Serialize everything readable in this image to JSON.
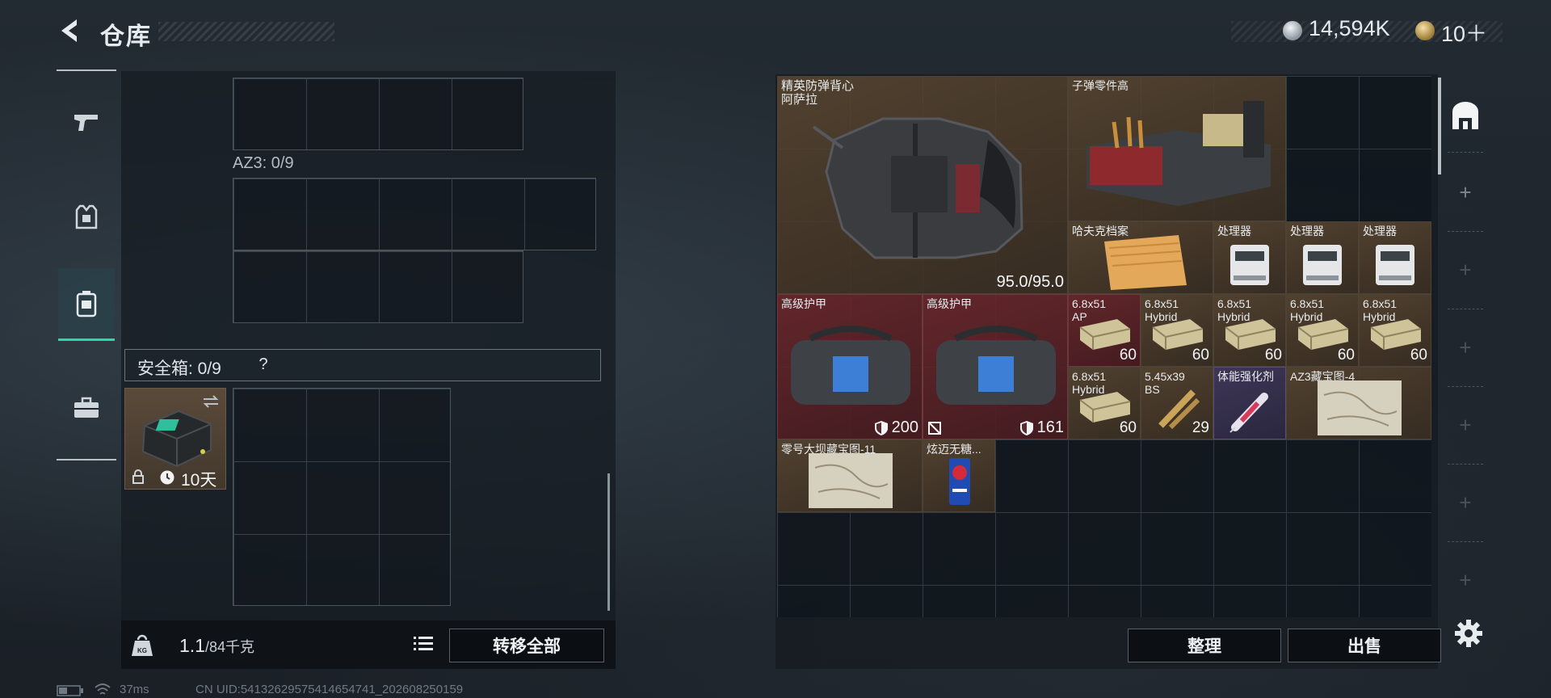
{
  "header": {
    "title": "仓库",
    "silver_amount": "14,594K",
    "gold_amount": "10＋",
    "colors": {
      "accent": "#2fd6a8",
      "text": "#e6ebef",
      "background": "#1e252c"
    }
  },
  "left_rail": {
    "items": [
      {
        "icon": "pistol-icon",
        "active": false
      },
      {
        "icon": "armor-icon",
        "active": false
      },
      {
        "icon": "backpack-icon",
        "active": true
      },
      {
        "icon": "toolbox-icon",
        "active": false
      }
    ]
  },
  "left_panel": {
    "az3_label": "AZ3: 0/9",
    "safe_box": {
      "label": "安全箱:  0/9",
      "help": "?",
      "duration": "10天"
    },
    "weight": {
      "current": "1.1",
      "capacity": "/84千克"
    },
    "transfer_all": "转移全部"
  },
  "inventory": {
    "items": [
      {
        "name": "精英防弹背心\n阿萨拉",
        "value": "95.0/95.0",
        "rarity": "brown"
      },
      {
        "name": "子弹零件高",
        "value": "",
        "rarity": "brown"
      },
      {
        "name": "哈夫克档案",
        "value": "",
        "rarity": "brown"
      },
      {
        "name": "处理器",
        "value": "",
        "rarity": "brown"
      },
      {
        "name": "处理器",
        "value": "",
        "rarity": "brown"
      },
      {
        "name": "处理器",
        "value": "",
        "rarity": "brown"
      },
      {
        "name": "高级护甲",
        "value": "200",
        "rarity": "red"
      },
      {
        "name": "高级护甲",
        "value": "161",
        "rarity": "red"
      },
      {
        "name": "6.8x51\nAP",
        "value": "60",
        "rarity": "red"
      },
      {
        "name": "6.8x51\nHybrid",
        "value": "60",
        "rarity": "brown"
      },
      {
        "name": "6.8x51\nHybrid",
        "value": "60",
        "rarity": "brown"
      },
      {
        "name": "6.8x51\nHybrid",
        "value": "60",
        "rarity": "brown"
      },
      {
        "name": "6.8x51\nHybrid",
        "value": "60",
        "rarity": "brown"
      },
      {
        "name": "6.8x51\nHybrid",
        "value": "60",
        "rarity": "brown"
      },
      {
        "name": "5.45x39\nBS",
        "value": "29",
        "rarity": "brown"
      },
      {
        "name": "体能强化剂",
        "value": "",
        "rarity": "purple"
      },
      {
        "name": "AZ3藏宝图-4",
        "value": "",
        "rarity": "brown"
      },
      {
        "name": "零号大坝藏宝图-11",
        "value": "",
        "rarity": "brown"
      },
      {
        "name": "炫迈无糖...",
        "value": "",
        "rarity": "brown"
      }
    ]
  },
  "actions": {
    "sort": "整理",
    "sell": "出售"
  },
  "status_bar": {
    "ping": "37ms",
    "uid": "CN UID:54132629575414654741_202608250159"
  }
}
